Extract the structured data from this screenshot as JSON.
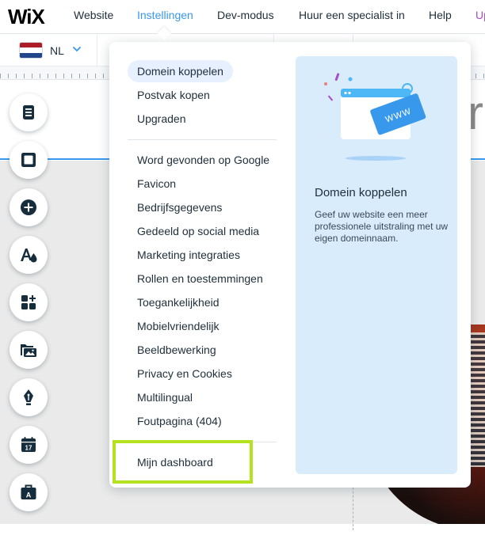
{
  "topbar": {
    "logo": "WiX",
    "nav": [
      "Website",
      "Instellingen",
      "Dev-modus",
      "Huur een specialist in",
      "Help",
      "Up"
    ],
    "active_index": 1
  },
  "language": {
    "code": "NL"
  },
  "canvas": {
    "partial_letter": "r"
  },
  "toolbar": {
    "icons": [
      "pages-icon",
      "background-icon",
      "add-icon",
      "design-icon",
      "apps-icon",
      "media-icon",
      "pen-icon",
      "bookings-calendar-icon",
      "business-briefcase-icon"
    ],
    "calendar_number": "17"
  },
  "dropdown": {
    "group1": [
      "Domein koppelen",
      "Postvak kopen",
      "Upgraden"
    ],
    "group2": [
      "Word gevonden op Google",
      "Favicon",
      "Bedrijfsgegevens",
      "Gedeeld op social media",
      "Marketing integraties",
      "Rollen en toestemmingen",
      "Toegankelijkheid",
      "Mobielvriendelijk",
      "Beeldbewerking",
      "Privacy en Cookies",
      "Multilingual",
      "Foutpagina (404)"
    ],
    "group3": [
      "Mijn dashboard"
    ],
    "selected": "Domein koppelen"
  },
  "info": {
    "title": "Domein koppelen",
    "description": "Geef uw website een meer professionele uitstraling met uw eigen domeinnaam.",
    "badge": "WWW"
  },
  "colors": {
    "accent": "#3899ec",
    "highlight": "#b5e21f",
    "panel": "#d9ecfc",
    "upgrade": "#aa4dc8"
  }
}
